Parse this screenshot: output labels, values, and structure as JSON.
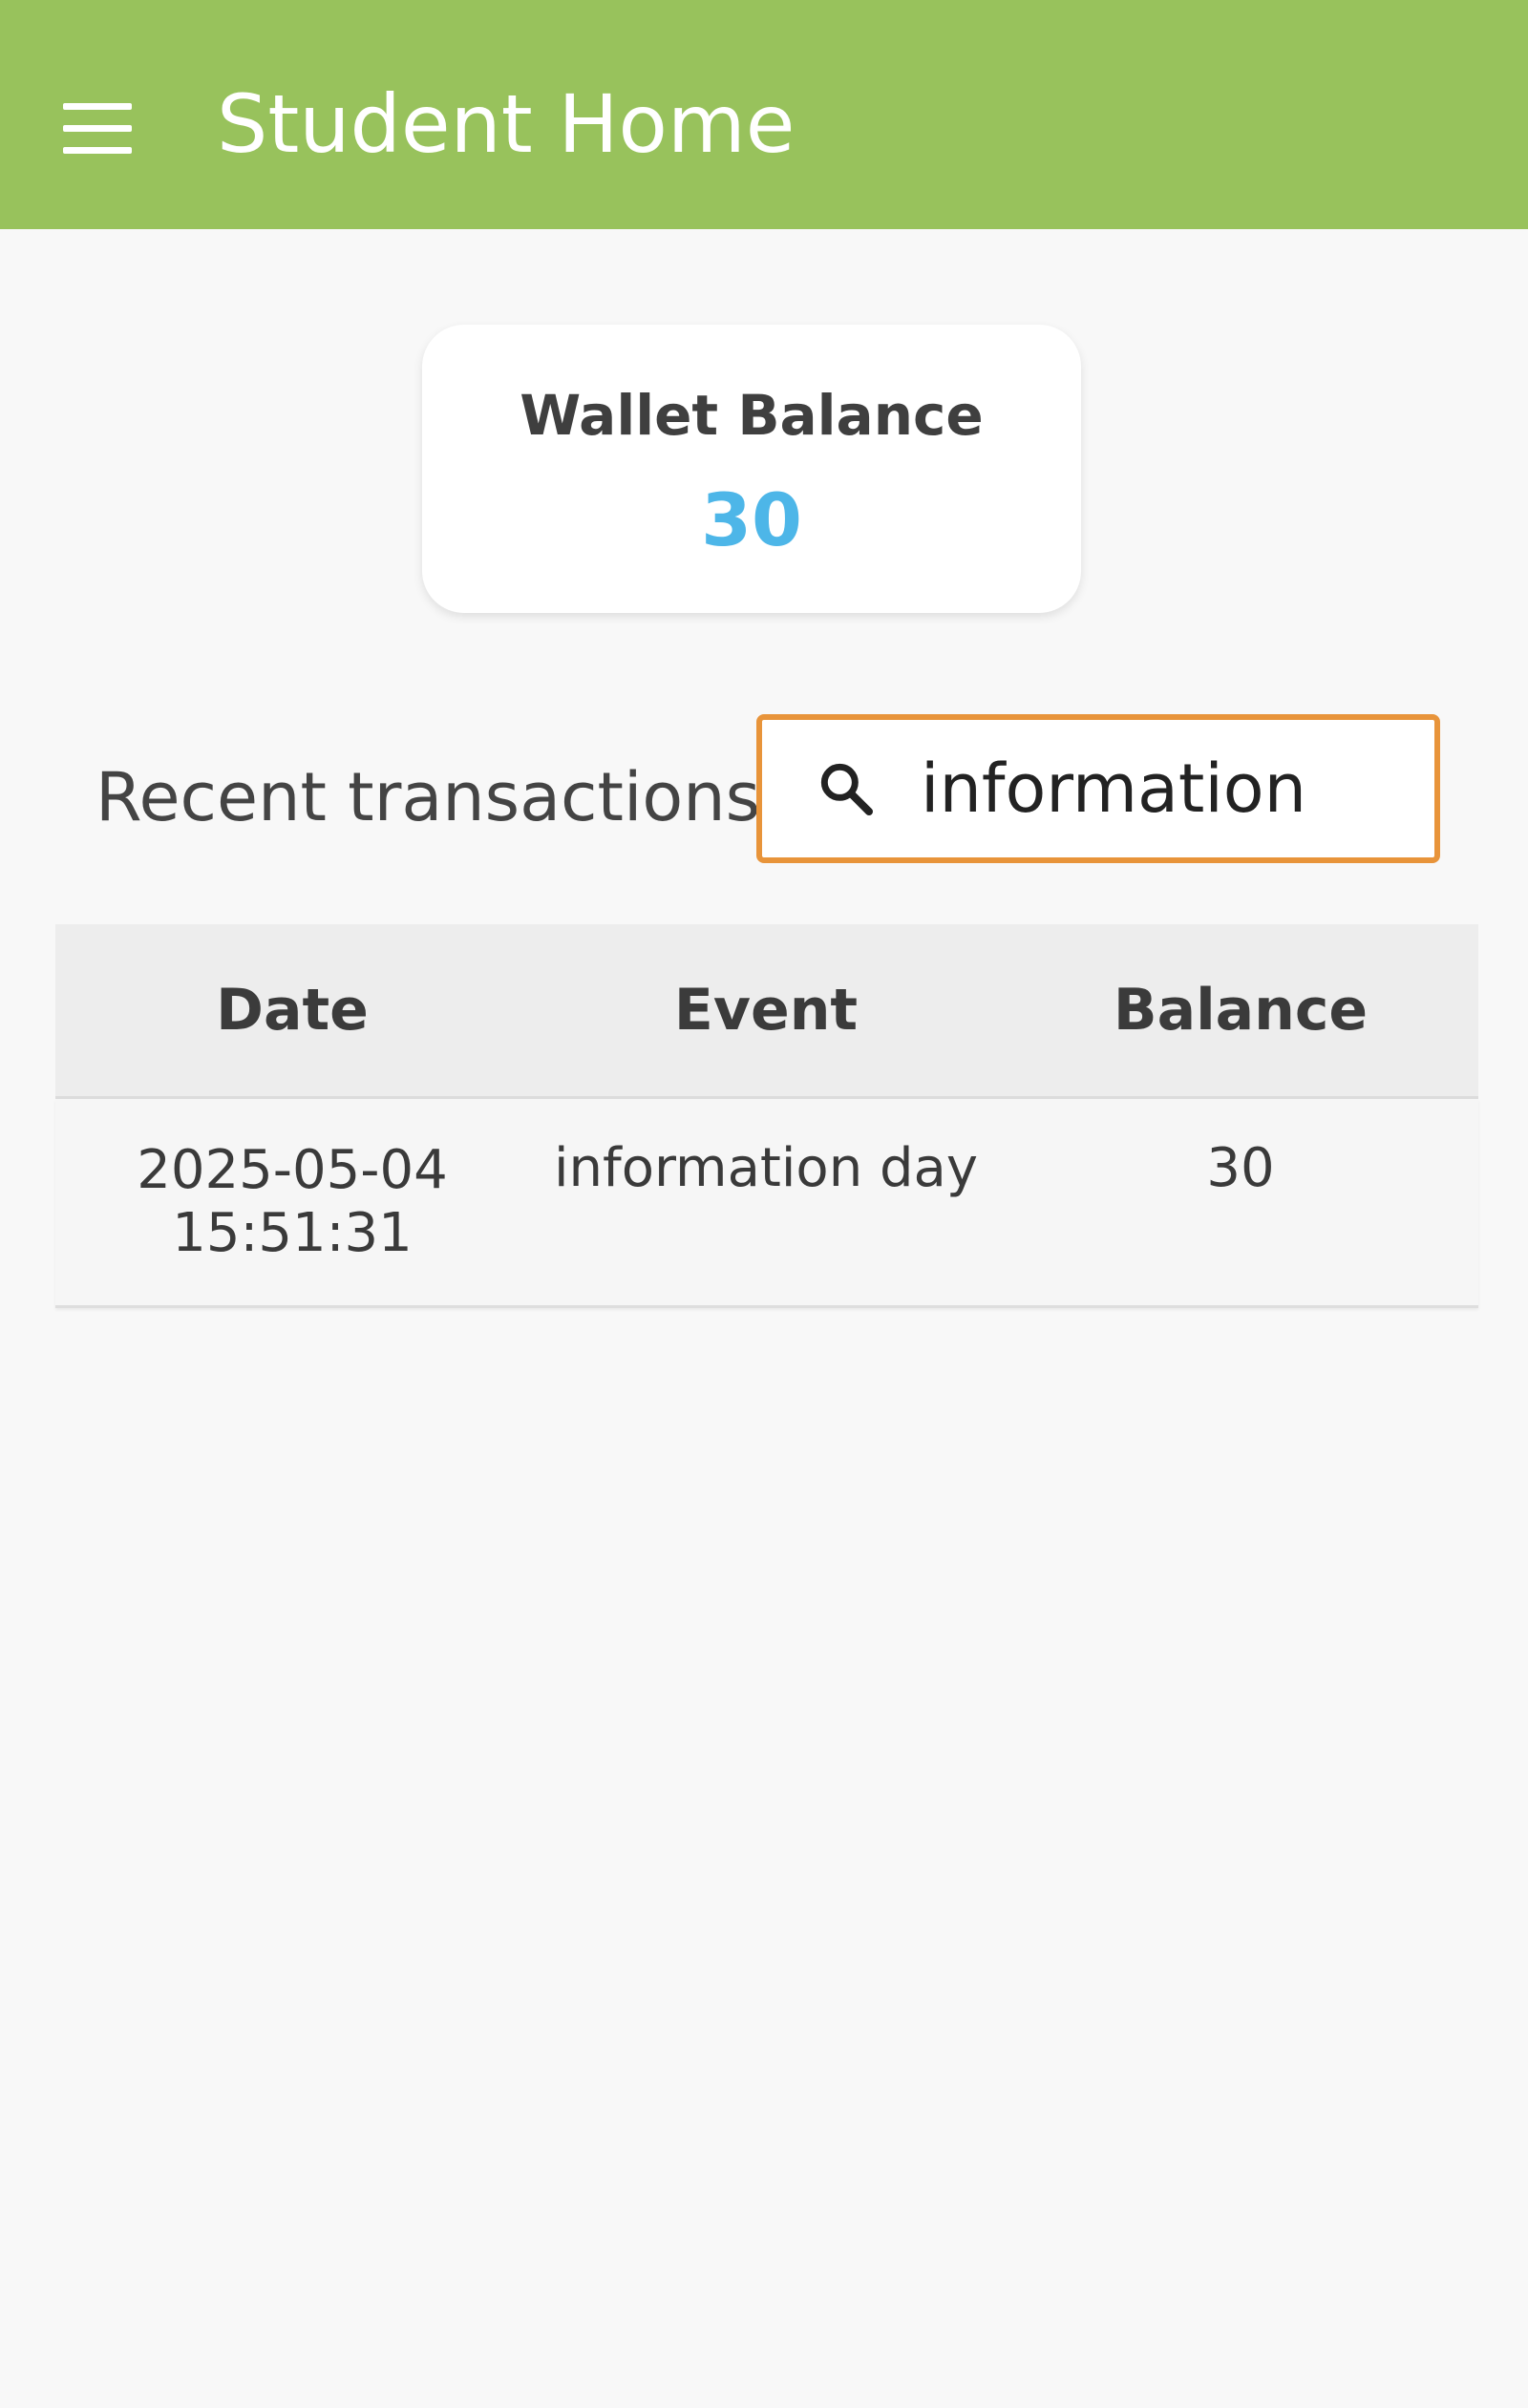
{
  "appbar": {
    "title": "Student Home",
    "background": "#98c25c",
    "menu_icon": "hamburger-menu-icon"
  },
  "wallet": {
    "label": "Wallet Balance",
    "amount": "30",
    "amount_color": "#4db6e8"
  },
  "transactions": {
    "title": "Recent transactions",
    "search": {
      "icon": "search-icon",
      "value": "information",
      "border_color": "#e8943a"
    },
    "columns": [
      "Date",
      "Event",
      "Balance"
    ],
    "rows": [
      {
        "date": "2025-05-04\n15:51:31",
        "event": "information day",
        "balance": "30"
      }
    ]
  }
}
